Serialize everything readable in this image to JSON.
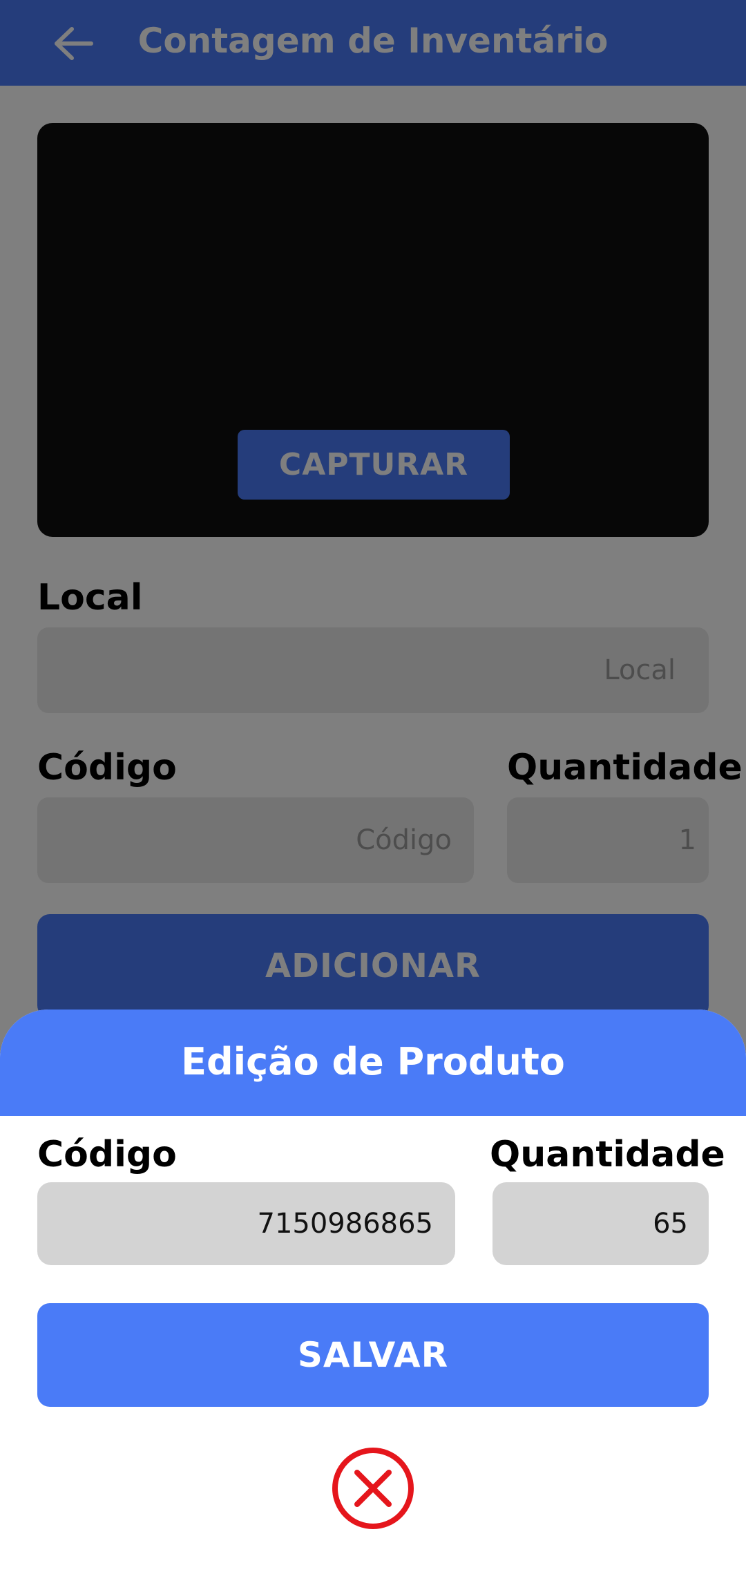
{
  "appbar": {
    "title": "Contagem de Inventário",
    "back_icon": "arrow-back-icon"
  },
  "camera": {
    "capture_label": "CAPTURAR"
  },
  "form": {
    "local_label": "Local",
    "local_placeholder": "Local",
    "codigo_label": "Código",
    "codigo_placeholder": "Código",
    "quantidade_label": "Quantidade",
    "quantidade_value": "1",
    "add_label": "ADICIONAR"
  },
  "sheet": {
    "title": "Edição de Produto",
    "codigo_label": "Código",
    "codigo_value": "7150986865",
    "quantidade_label": "Quantidade",
    "quantidade_value": "65",
    "save_label": "SALVAR",
    "close_icon": "close-circle-icon"
  },
  "colors": {
    "primary": "#4a7bf7",
    "close": "#e5161c",
    "camera_bg": "#0e0e0e",
    "field_bg": "#d3d3d3"
  }
}
